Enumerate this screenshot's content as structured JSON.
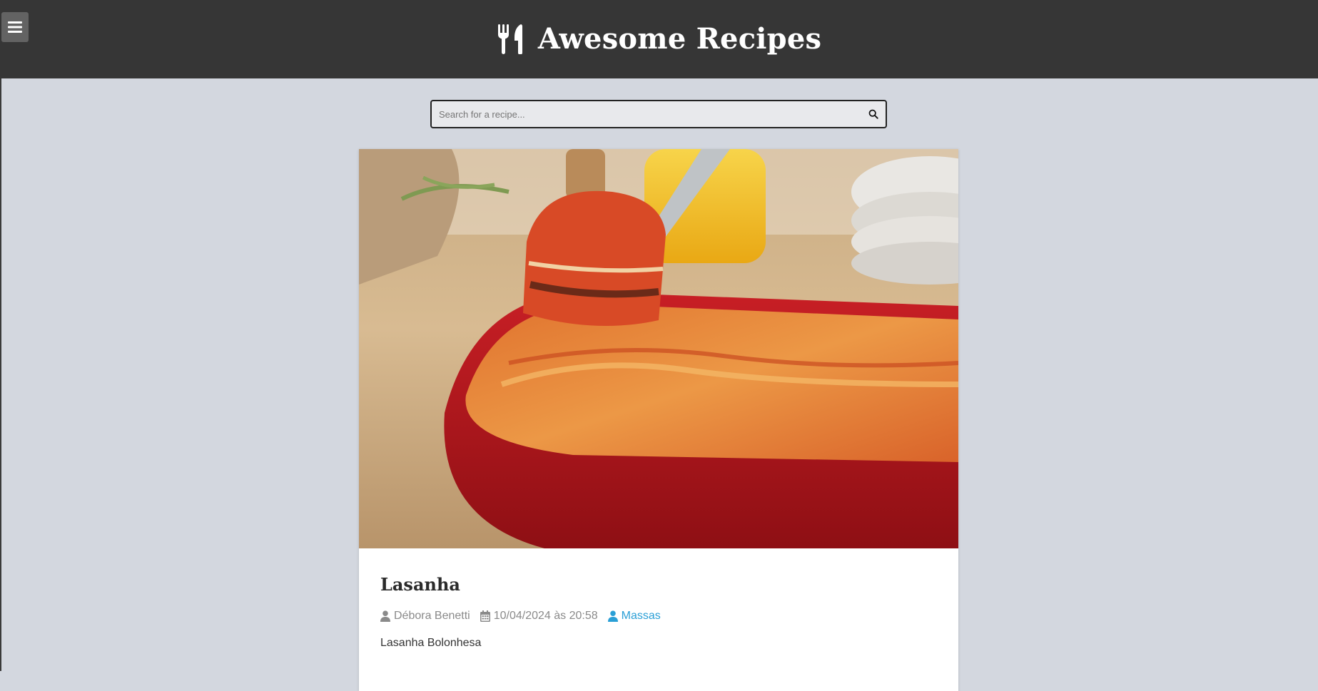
{
  "header": {
    "title": "Awesome Recipes",
    "logo_icon": "utensils-icon",
    "menu_icon": "hamburger-menu-icon",
    "background": "#363636"
  },
  "search": {
    "placeholder": "Search for a recipe...",
    "value": "",
    "icon": "search-icon"
  },
  "recipe": {
    "title": "Lasanha",
    "image_alt": "Lasanha Bolonhesa",
    "author": "Débora Benetti",
    "date": "10/04/2024 às 20:58",
    "category": "Massas",
    "description": "Lasanha Bolonhesa",
    "link_color": "#2a9fd6"
  },
  "colors": {
    "page_background": "#d3d7df",
    "card_background": "#ffffff"
  }
}
